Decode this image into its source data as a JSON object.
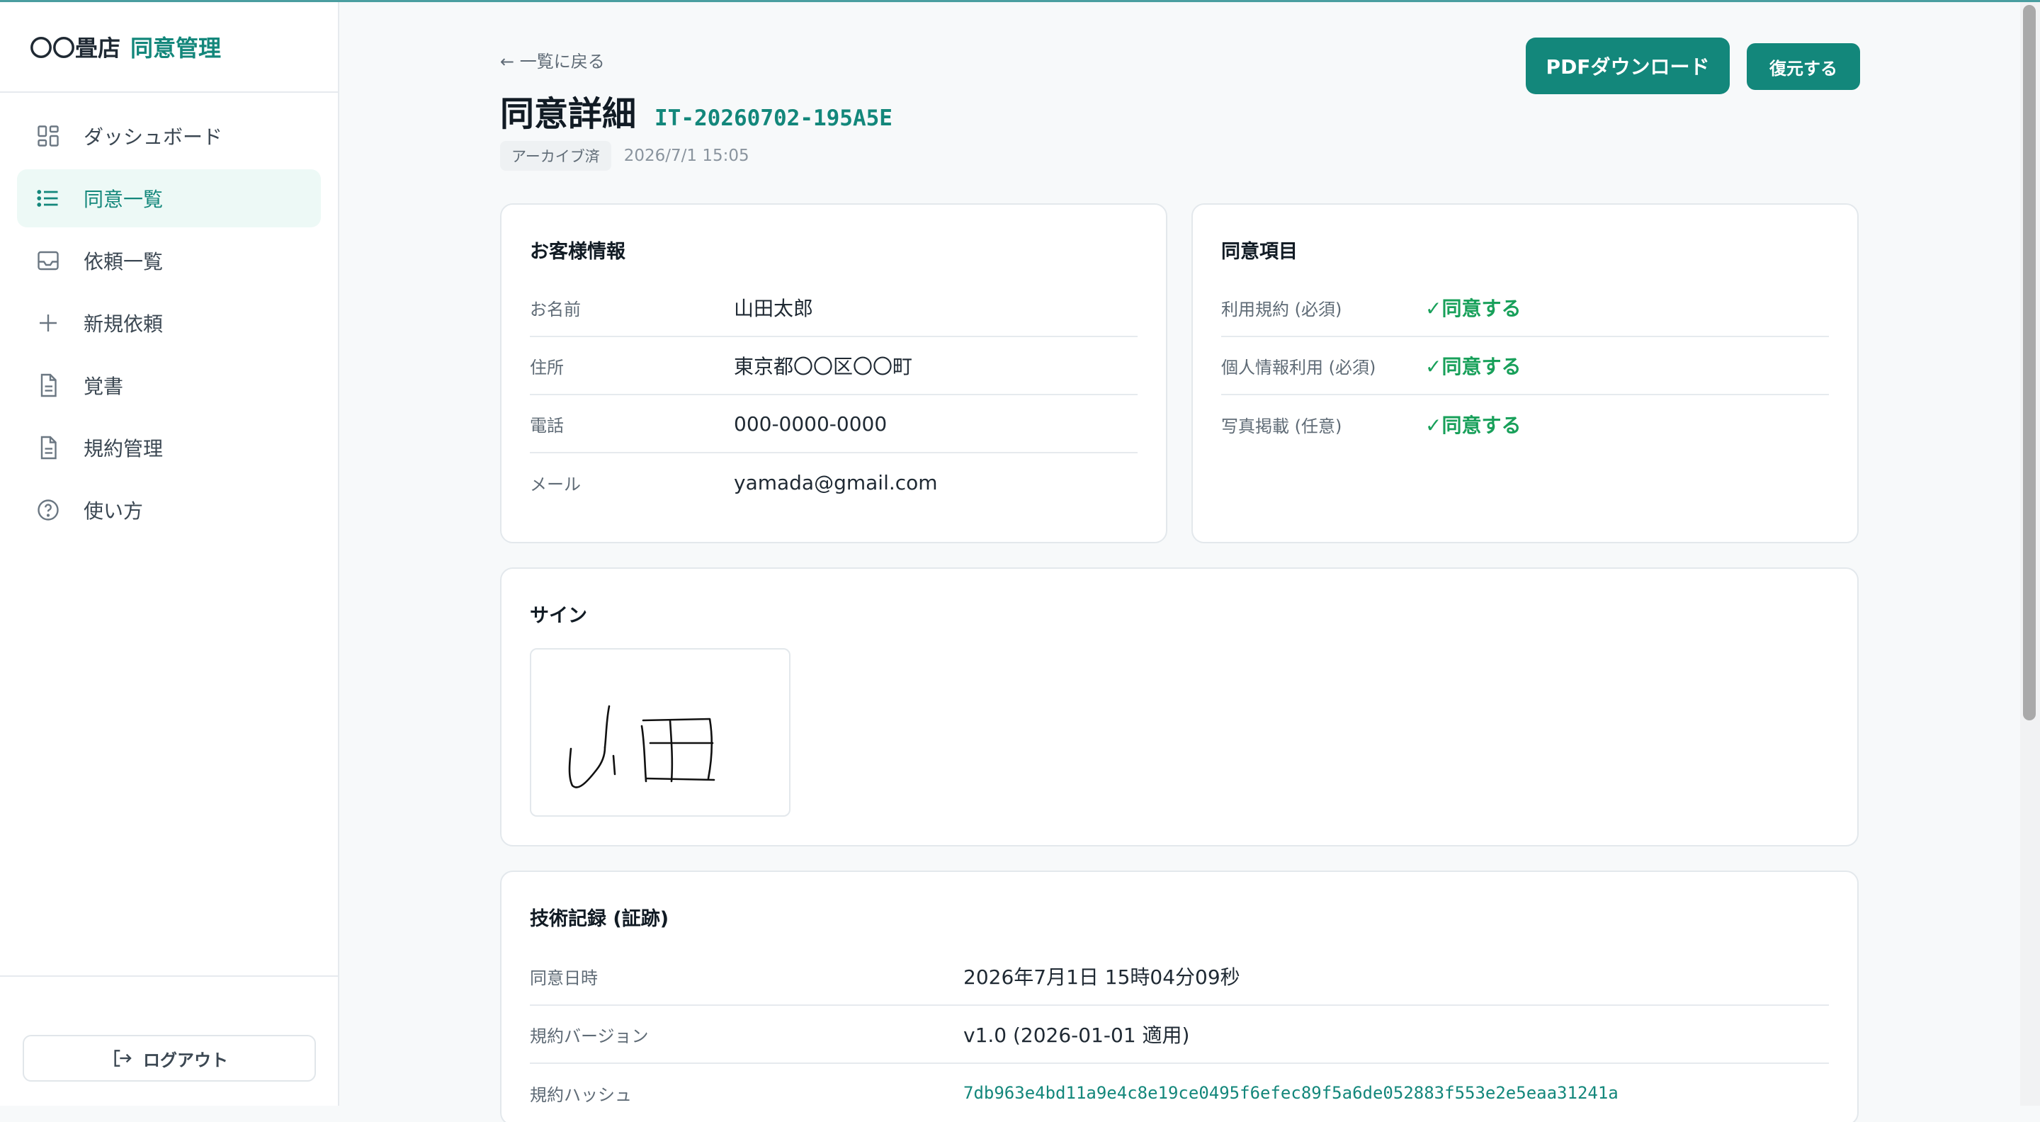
{
  "sidebar": {
    "brand_store": "〇〇畳店",
    "brand_app": "同意管理",
    "items": [
      {
        "label": "ダッシュボード",
        "icon": "dashboard-icon"
      },
      {
        "label": "同意一覧",
        "icon": "list-icon",
        "active": true
      },
      {
        "label": "依頼一覧",
        "icon": "inbox-icon"
      },
      {
        "label": "新規依頼",
        "icon": "plus-icon"
      },
      {
        "label": "覚書",
        "icon": "document-icon"
      },
      {
        "label": "規約管理",
        "icon": "document-icon"
      },
      {
        "label": "使い方",
        "icon": "help-icon"
      }
    ],
    "logout_label": "ログアウト"
  },
  "header": {
    "back_label": "← 一覧に戻る",
    "title": "同意詳細",
    "consent_id": "IT-20260702-195A5E",
    "status_badge": "アーカイブ済",
    "timestamp": "2026/7/1 15:05",
    "pdf_button": "PDFダウンロード",
    "restore_button": "復元する"
  },
  "customer": {
    "title": "お客様情報",
    "rows": [
      {
        "label": "お名前",
        "value": "山田太郎"
      },
      {
        "label": "住所",
        "value": "東京都〇〇区〇〇町"
      },
      {
        "label": "電話",
        "value": "000-0000-0000"
      },
      {
        "label": "メール",
        "value": "yamada@gmail.com"
      }
    ]
  },
  "consents": {
    "title": "同意項目",
    "rows": [
      {
        "label": "利用規約 (必須)",
        "value": "✓同意する"
      },
      {
        "label": "個人情報利用 (必須)",
        "value": "✓同意する"
      },
      {
        "label": "写真掲載 (任意)",
        "value": "✓同意する"
      }
    ]
  },
  "signature": {
    "title": "サイン"
  },
  "technical": {
    "title": "技術記録 (証跡)",
    "rows": [
      {
        "label": "同意日時",
        "value": "2026年7月1日 15時04分09秒"
      },
      {
        "label": "規約バージョン",
        "value": "v1.0 (2026-01-01 適用)"
      },
      {
        "label": "規約ハッシュ",
        "value": "7db963e4bd11a9e4c8e19ce0495f6efec89f5a6de052883f553e2e5eaa31241a"
      }
    ]
  },
  "colors": {
    "accent": "#13877b",
    "check": "#18a05a",
    "active_bg": "#edf9f6"
  }
}
